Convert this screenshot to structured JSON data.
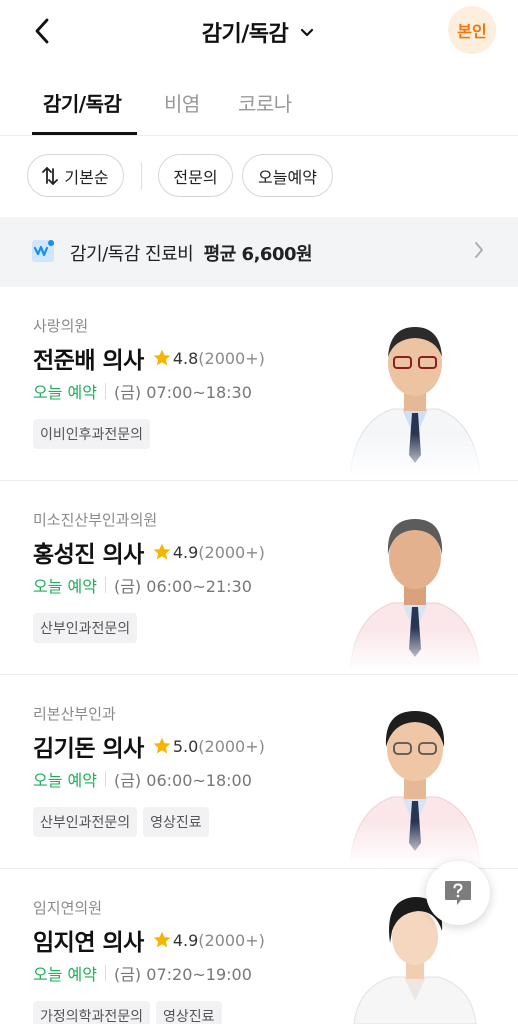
{
  "header": {
    "title": "감기/독감",
    "self_label": "본인"
  },
  "tabs": [
    {
      "label": "감기/독감",
      "active": true
    },
    {
      "label": "비염",
      "active": false
    },
    {
      "label": "코로나",
      "active": false
    }
  ],
  "filters": {
    "sort_label": "기본순",
    "specialist_label": "전문의",
    "today_label": "오늘예약"
  },
  "banner": {
    "prefix": "감기/독감 진료비",
    "highlight": "평균 6,600원"
  },
  "doctors": [
    {
      "clinic": "사랑의원",
      "name": "전준배 의사",
      "rating": "4.8",
      "reviews": "(2000+)",
      "availability": "오늘 예약",
      "hours": "(금) 07:00~18:30",
      "tags": [
        "이비인후과전문의"
      ]
    },
    {
      "clinic": "미소진산부인과의원",
      "name": "홍성진 의사",
      "rating": "4.9",
      "reviews": "(2000+)",
      "availability": "오늘 예약",
      "hours": "(금) 06:00~21:30",
      "tags": [
        "산부인과전문의"
      ]
    },
    {
      "clinic": "리본산부인과",
      "name": "김기돈 의사",
      "rating": "5.0",
      "reviews": "(2000+)",
      "availability": "오늘 예약",
      "hours": "(금) 06:00~18:00",
      "tags": [
        "산부인과전문의",
        "영상진료"
      ]
    },
    {
      "clinic": "임지연의원",
      "name": "임지연 의사",
      "rating": "4.9",
      "reviews": "(2000+)",
      "availability": "오늘 예약",
      "hours": "(금) 07:20~19:00",
      "tags": [
        "가정의학과전문의",
        "영상진료"
      ]
    }
  ],
  "colors": {
    "accent_orange": "#f0780a",
    "available_green": "#1fae5a",
    "star_yellow": "#f7b500"
  },
  "icons": {
    "back": "chevron-left-icon",
    "title_dropdown": "chevron-down-icon",
    "sort": "sort-arrows-icon",
    "banner": "price-wave-icon",
    "banner_arrow": "chevron-right-icon",
    "rating": "star-icon",
    "help": "question-bubble-icon"
  }
}
